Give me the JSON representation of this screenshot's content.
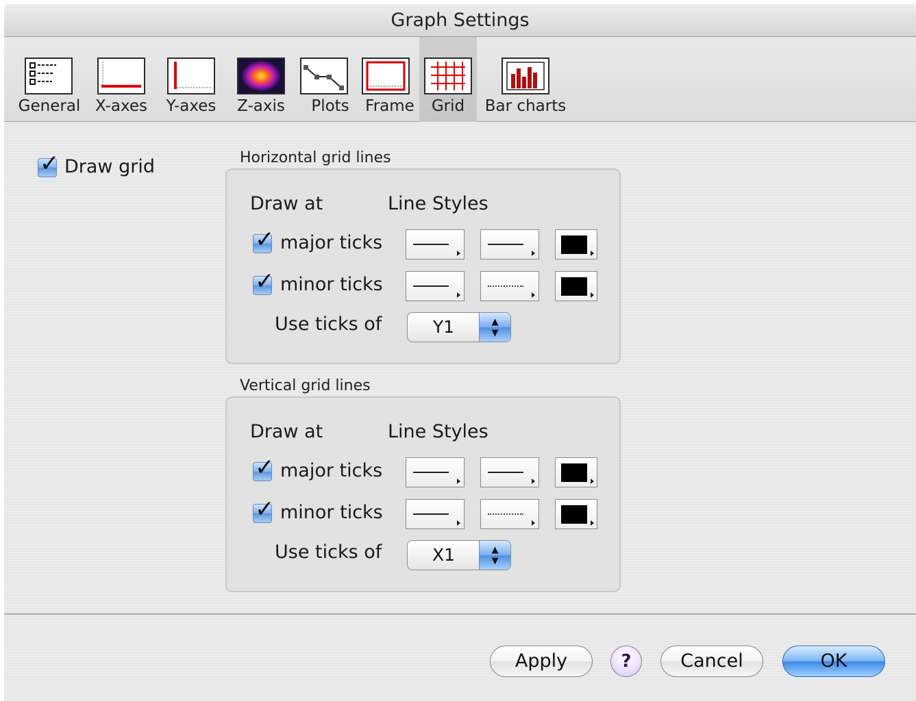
{
  "window": {
    "title": "Graph Settings"
  },
  "toolbar": {
    "tabs": [
      {
        "label": "General",
        "icon": "general-list-icon"
      },
      {
        "label": "X-axes",
        "icon": "x-axis-icon"
      },
      {
        "label": "Y-axes",
        "icon": "y-axis-icon"
      },
      {
        "label": "Z-axis",
        "icon": "z-axis-heatmap-icon"
      },
      {
        "label": "Plots",
        "icon": "plots-line-icon"
      },
      {
        "label": "Frame",
        "icon": "frame-icon"
      },
      {
        "label": "Grid",
        "icon": "grid-icon",
        "selected": true
      },
      {
        "label": "Bar charts",
        "icon": "bar-chart-icon"
      }
    ]
  },
  "draw_grid": {
    "label": "Draw grid",
    "checked": true
  },
  "horizontal": {
    "title": "Horizontal grid lines",
    "draw_at_header": "Draw at",
    "line_styles_header": "Line Styles",
    "major": {
      "label": "major ticks",
      "checked": true
    },
    "minor": {
      "label": "minor ticks",
      "checked": true
    },
    "use_ticks_label": "Use ticks of",
    "use_ticks_value": "Y1"
  },
  "vertical": {
    "title": "Vertical grid lines",
    "draw_at_header": "Draw at",
    "line_styles_header": "Line Styles",
    "major": {
      "label": "major ticks",
      "checked": true
    },
    "minor": {
      "label": "minor ticks",
      "checked": true
    },
    "use_ticks_label": "Use ticks of",
    "use_ticks_value": "X1"
  },
  "buttons": {
    "apply": "Apply",
    "help": "?",
    "cancel": "Cancel",
    "ok": "OK"
  },
  "colors": {
    "line_color": "#000000",
    "default_button": "#3f8ae6"
  }
}
